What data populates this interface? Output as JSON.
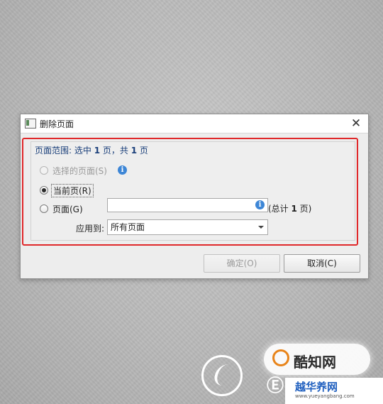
{
  "dialog": {
    "title": "删除页面",
    "close_glyph": "✕",
    "icon": "app-window-icon"
  },
  "page_range": {
    "title_prefix": "页面范围: 选中 ",
    "selected_count": "1",
    "title_middle": " 页，共 ",
    "total_count": "1",
    "title_suffix": " 页",
    "options": [
      {
        "label": "选择的页面(S)",
        "enabled": false,
        "checked": false,
        "info_icon": true
      },
      {
        "label": "当前页(R)",
        "enabled": true,
        "checked": true
      },
      {
        "label": "页面(G)",
        "enabled": true,
        "checked": false
      }
    ],
    "pages_input_value": "",
    "info_glyph": "i",
    "total_prefix": "(总计 ",
    "total_value": "1",
    "total_suffix": " 页)",
    "apply_to_label": "应用到:",
    "apply_to_value": "所有页面"
  },
  "buttons": {
    "ok": "确定(O)",
    "cancel": "取消(C)"
  },
  "watermark": {
    "brand": "酷知网",
    "site": "越华养网",
    "url": "www.yueyangbang.com",
    "mark": "Ⓔ"
  },
  "colors": {
    "highlight": "#e0282a",
    "info_icon": "#3d86d6",
    "group_title": "#1a3f7a",
    "logo_ring": "#e8841a"
  }
}
